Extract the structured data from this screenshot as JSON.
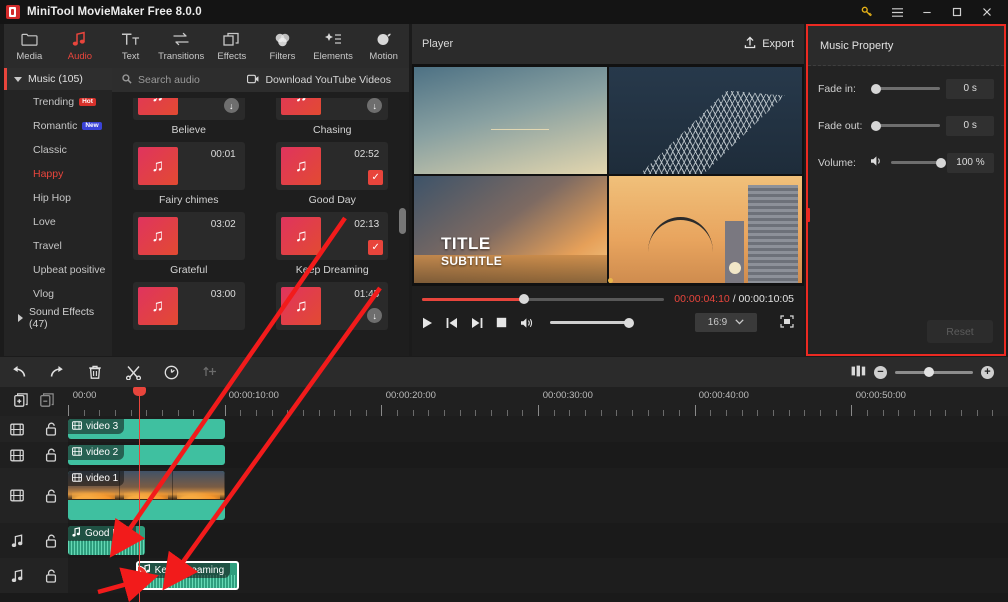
{
  "window": {
    "title": "MiniTool MovieMaker Free 8.0.0",
    "controls": [
      {
        "name": "key-icon",
        "glyph": "⚿"
      },
      {
        "name": "menu-icon",
        "glyph": "☰"
      },
      {
        "name": "minimize-icon",
        "glyph": "—"
      },
      {
        "name": "maximize-icon",
        "glyph": "❐"
      },
      {
        "name": "close-icon",
        "glyph": "✕"
      }
    ]
  },
  "toolbar": {
    "items": [
      {
        "label": "Media",
        "icon": "folder-icon",
        "active": false
      },
      {
        "label": "Audio",
        "icon": "music-note-icon",
        "active": true
      },
      {
        "label": "Text",
        "icon": "text-icon",
        "active": false
      },
      {
        "label": "Transitions",
        "icon": "transitions-icon",
        "active": false
      },
      {
        "label": "Effects",
        "icon": "effects-icon",
        "active": false
      },
      {
        "label": "Filters",
        "icon": "filters-icon",
        "active": false
      },
      {
        "label": "Elements",
        "icon": "elements-icon",
        "active": false
      },
      {
        "label": "Motion",
        "icon": "motion-icon",
        "active": false
      }
    ]
  },
  "sidebar": {
    "music_header": "Music (105)",
    "items": [
      {
        "label": "Trending",
        "badge": "Hot",
        "badge_type": "hot",
        "selected": false
      },
      {
        "label": "Romantic",
        "badge": "New",
        "badge_type": "new",
        "selected": false
      },
      {
        "label": "Classic",
        "badge": "",
        "badge_type": "",
        "selected": false
      },
      {
        "label": "Happy",
        "badge": "",
        "badge_type": "",
        "selected": true
      },
      {
        "label": "Hip Hop",
        "badge": "",
        "badge_type": "",
        "selected": false
      },
      {
        "label": "Love",
        "badge": "",
        "badge_type": "",
        "selected": false
      },
      {
        "label": "Travel",
        "badge": "",
        "badge_type": "",
        "selected": false
      },
      {
        "label": "Upbeat positive",
        "badge": "",
        "badge_type": "",
        "selected": false
      },
      {
        "label": "Vlog",
        "badge": "",
        "badge_type": "",
        "selected": false
      }
    ],
    "sound_effects": "Sound Effects (47)"
  },
  "library": {
    "search_placeholder": "Search audio",
    "download_label": "Download YouTube Videos",
    "partial_cards": [
      {
        "name": "Believe",
        "state": "download"
      },
      {
        "name": "Chasing",
        "state": "download"
      }
    ],
    "cards": [
      {
        "name": "Fairy chimes",
        "duration": "00:01",
        "state": "none"
      },
      {
        "name": "Good Day",
        "duration": "02:52",
        "state": "checked"
      },
      {
        "name": "Grateful",
        "duration": "03:02",
        "state": "none"
      },
      {
        "name": "Keep Dreaming",
        "duration": "02:13",
        "state": "checked"
      },
      {
        "name": "",
        "duration": "03:00",
        "state": "none"
      },
      {
        "name": "",
        "duration": "01:45",
        "state": "download"
      }
    ]
  },
  "player": {
    "title": "Player",
    "export_label": "Export",
    "preview_title": "TITLE",
    "preview_subtitle": "SUBTITLE",
    "current_time": "00:00:04:10",
    "separator": "/",
    "total_time": "00:00:10:05",
    "progress_percent": 42,
    "aspect_ratio": "16:9",
    "controls": [
      {
        "name": "play-button",
        "glyph": "▶"
      },
      {
        "name": "previous-frame-button",
        "glyph": "⏮"
      },
      {
        "name": "next-frame-button",
        "glyph": "⏭"
      },
      {
        "name": "stop-button",
        "glyph": "■"
      },
      {
        "name": "volume-icon",
        "glyph": "🔊"
      }
    ]
  },
  "property": {
    "title": "Music Property",
    "rows": [
      {
        "label": "Fade in:",
        "value": "0 s",
        "knob_percent": 0
      },
      {
        "label": "Fade out:",
        "value": "0 s",
        "knob_percent": 0
      },
      {
        "label": "Volume:",
        "value": "100 %",
        "knob_percent": 100
      }
    ],
    "reset_label": "Reset",
    "accent_color": "#ec2a22"
  },
  "timeline_toolbar": {
    "buttons": [
      {
        "name": "undo-button",
        "glyph": "↶",
        "dim": false
      },
      {
        "name": "redo-button",
        "glyph": "↷",
        "dim": false
      },
      {
        "name": "delete-button",
        "glyph": "🗑",
        "dim": false
      },
      {
        "name": "split-button",
        "glyph": "✂",
        "dim": false
      },
      {
        "name": "speed-button",
        "glyph": "⊙",
        "dim": false
      },
      {
        "name": "add-marker-button",
        "glyph": "↑",
        "dim": true
      }
    ],
    "zoom": {
      "fit-icon": "⬚",
      "minus": "−",
      "plus": "+",
      "value_percent": 44
    }
  },
  "timeline": {
    "ruler_labels": [
      {
        "text": "00:00",
        "pos_percent": 0
      },
      {
        "text": "00:00:10:00",
        "pos_percent": 16.6
      },
      {
        "text": "00:00:20:00",
        "pos_percent": 33.3
      },
      {
        "text": "00:00:30:00",
        "pos_percent": 50
      },
      {
        "text": "00:00:40:00",
        "pos_percent": 66.6
      },
      {
        "text": "00:00:50:00",
        "pos_percent": 83.3
      }
    ],
    "playhead_percent": 7.6,
    "tracks": [
      {
        "type": "video",
        "lock": "unlocked",
        "clips": [
          {
            "label": "video 3",
            "left_percent": 0,
            "width_percent": 16.7,
            "kind": "plain",
            "selected": false
          }
        ]
      },
      {
        "type": "video",
        "lock": "unlocked",
        "clips": [
          {
            "label": "video 2",
            "left_percent": 0,
            "width_percent": 16.7,
            "kind": "plain",
            "selected": false
          }
        ]
      },
      {
        "type": "video",
        "lock": "unlocked",
        "clips": [
          {
            "label": "video 1",
            "left_percent": 0,
            "width_percent": 16.7,
            "kind": "filmstrip",
            "selected": false
          }
        ]
      },
      {
        "type": "audio",
        "lock": "unlocked",
        "clips": [
          {
            "label": "Good Day",
            "left_percent": 0,
            "width_percent": 8.2,
            "kind": "audio",
            "selected": false
          }
        ]
      },
      {
        "type": "audio",
        "lock": "unlocked",
        "clips": [
          {
            "label": "Keep Dreaming",
            "left_percent": 7.2,
            "width_percent": 11.0,
            "kind": "audio",
            "selected": true
          }
        ]
      }
    ]
  }
}
